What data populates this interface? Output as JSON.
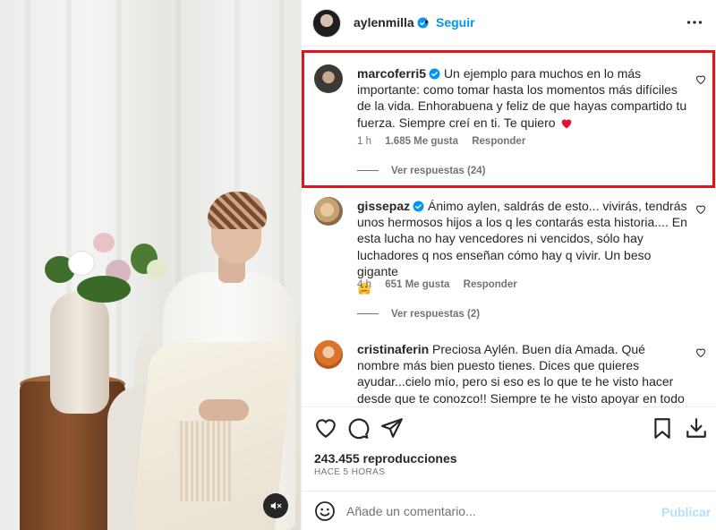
{
  "header": {
    "username": "aylenmilla",
    "separator": "•",
    "follow_label": "Seguir"
  },
  "comments": [
    {
      "username": "marcoferri5",
      "text": "Un ejemplo para muchos en lo más importante: como tomar hasta los momentos más difíciles de la vida. Enhorabuena y feliz de que hayas compartido tu fuerza. Siempre creí en ti. Te quiero",
      "time": "1 h",
      "likes": "1.685 Me gusta",
      "reply_label": "Responder",
      "view_replies": "Ver respuestas (24)"
    },
    {
      "username": "gissepaz",
      "text": "Ánimo aylen, saldrás de esto... vivirás, tendrás unos hermosos hijos a los q les contarás esta historia.... En esta lucha no hay vencedores ni vencidos, sólo hay luchadores q nos enseñan cómo hay q vivir. Un beso gigante",
      "time": "4 h",
      "likes": "651 Me gusta",
      "reply_label": "Responder",
      "view_replies": "Ver respuestas (2)"
    },
    {
      "username": "cristinaferin",
      "text": "Preciosa Aylén. Buen día Amada. Qué nombre más bien puesto tienes. Dices que quieres ayudar...cielo mío, pero si eso es lo que te he visto hacer desde que te conozco!! Siempre te he visto apoyar en todo a las personas que te rodeaban,"
    }
  ],
  "stats": {
    "views": "243.455 reproducciones",
    "posted_ago": "Hace 5 horas"
  },
  "composer": {
    "placeholder": "Añade un comentario...",
    "publish_label": "Publicar"
  },
  "icons": {
    "heart": "heart-icon",
    "comment": "comment-icon",
    "share": "share-icon",
    "save": "bookmark-icon",
    "download": "download-icon",
    "emoji": "emoji-icon",
    "more": "more-options-icon",
    "mute": "mute-icon"
  },
  "colors": {
    "accent": "#0095f6",
    "highlight_border": "#e1141e",
    "muted_text": "#737373",
    "publish_disabled": "#b2dffc",
    "heart_emoji": "#e0142b"
  }
}
